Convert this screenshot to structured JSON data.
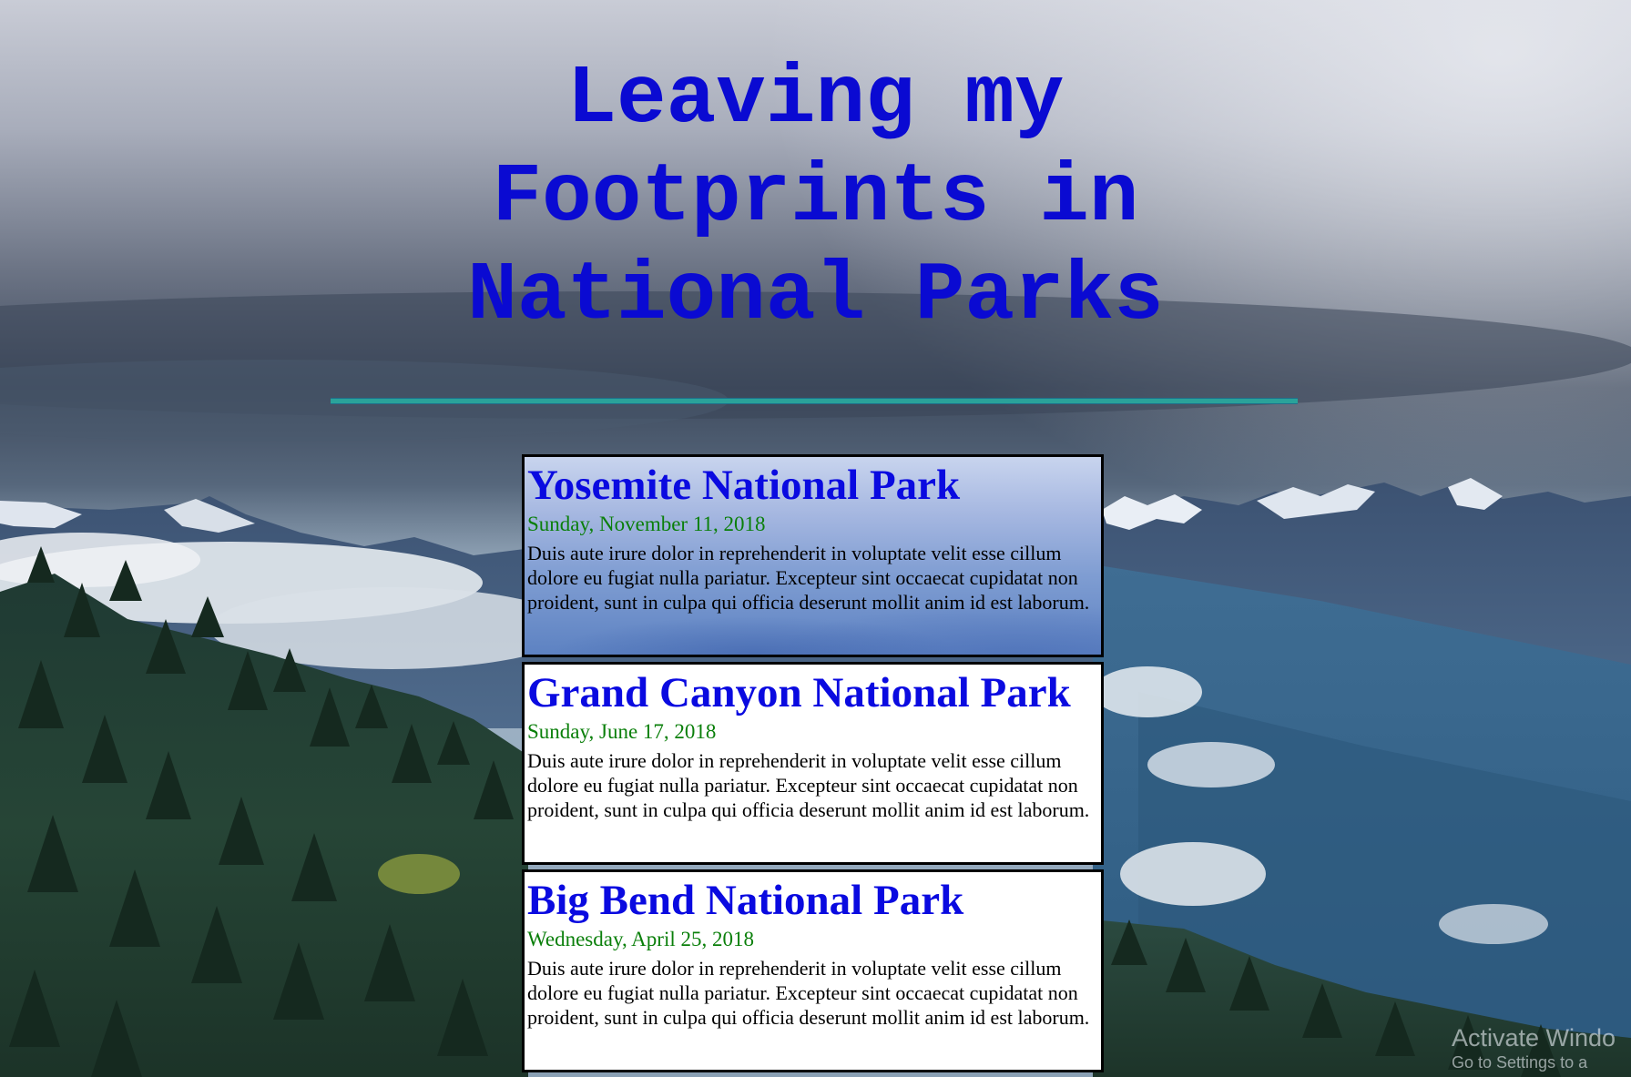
{
  "header": {
    "title_lines": [
      "Leaving my",
      "Footprints in",
      "National Parks"
    ]
  },
  "posts": [
    {
      "title": "Yosemite National Park",
      "date": "Sunday, November 11, 2018",
      "body": "Duis aute irure dolor in reprehenderit in voluptate velit esse cillum dolore eu fugiat nulla pariatur. Excepteur sint occaecat cupidatat non proident, sunt in culpa qui officia deserunt mollit anim id est laborum."
    },
    {
      "title": "Grand Canyon National Park",
      "date": "Sunday, June 17, 2018",
      "body": "Duis aute irure dolor in reprehenderit in voluptate velit esse cillum dolore eu fugiat nulla pariatur. Excepteur sint occaecat cupidatat non proident, sunt in culpa qui officia deserunt mollit anim id est laborum."
    },
    {
      "title": "Big Bend National Park",
      "date": "Wednesday, April 25, 2018",
      "body": "Duis aute irure dolor in reprehenderit in voluptate velit esse cillum dolore eu fugiat nulla pariatur. Excepteur sint occaecat cupidatat non proident, sunt in culpa qui officia deserunt mollit anim id est laborum."
    }
  ],
  "watermark": {
    "title": "Activate Windo",
    "subtitle": "Go to Settings to a"
  },
  "colors": {
    "title": "#0a0ad2",
    "post_title": "#0a0ae0",
    "post_date": "#0a7f0a",
    "rule": "#2aa29a"
  }
}
